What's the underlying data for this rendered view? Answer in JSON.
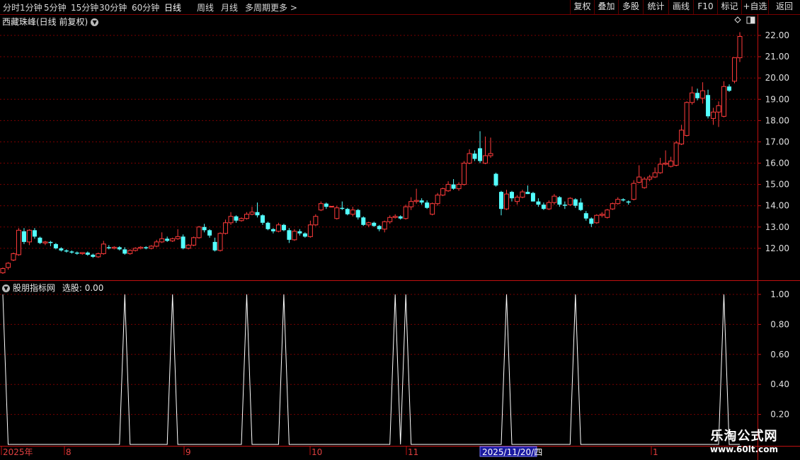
{
  "toolbar": {
    "periods": [
      "分时",
      "1分钟",
      "5分钟",
      "15分钟",
      "30分钟",
      "60分钟",
      "日线",
      "周线",
      "月线",
      "多周期",
      "更多 >"
    ],
    "active_period": "日线",
    "right_buttons": [
      "复权",
      "叠加",
      "多股",
      "统计",
      "画线",
      "F10",
      "标记",
      "+自选",
      "返回"
    ]
  },
  "main_chart": {
    "title": "西藏珠峰(日线 前复权)",
    "dropdown_icon": "chevron-down-icon",
    "price_labels": [
      "22.00",
      "21.00",
      "20.00",
      "19.00",
      "18.00",
      "17.00",
      "16.00",
      "15.00",
      "14.00",
      "13.00",
      "12.00"
    ],
    "up_color": "#ff3b3b",
    "down_color": "#54ffff"
  },
  "indicator": {
    "title": "股朋指标网",
    "select_label": "选股: 0.00",
    "axis_labels": [
      "1.00",
      "0.80",
      "0.60",
      "0.40",
      "0.20"
    ],
    "line_color": "#ffffff"
  },
  "time_axis": {
    "labels": [
      "2025年",
      "8",
      "9",
      "10",
      "11",
      "1"
    ],
    "cursor_date": "2025/11/20/四"
  },
  "chart_data": {
    "type": "candlestick",
    "candles": [
      [
        10.85,
        11.1,
        10.8,
        11.05
      ],
      [
        11.1,
        11.35,
        11.0,
        11.3
      ],
      [
        11.45,
        11.8,
        11.4,
        11.75
      ],
      [
        11.7,
        12.95,
        11.65,
        12.85
      ],
      [
        12.8,
        12.95,
        12.2,
        12.3
      ],
      [
        12.3,
        12.9,
        12.15,
        12.85
      ],
      [
        12.85,
        12.95,
        12.45,
        12.55
      ],
      [
        12.5,
        12.55,
        12.2,
        12.25
      ],
      [
        12.25,
        12.35,
        12.15,
        12.3
      ],
      [
        12.3,
        12.35,
        12.1,
        12.25
      ],
      [
        12.2,
        12.25,
        11.95,
        12.0
      ],
      [
        12.0,
        12.05,
        11.85,
        11.9
      ],
      [
        11.9,
        11.95,
        11.8,
        11.85
      ],
      [
        11.85,
        11.9,
        11.75,
        11.8
      ],
      [
        11.8,
        11.85,
        11.7,
        11.75
      ],
      [
        11.75,
        11.8,
        11.7,
        11.8
      ],
      [
        11.8,
        11.85,
        11.65,
        11.7
      ],
      [
        11.7,
        11.75,
        11.55,
        11.6
      ],
      [
        11.6,
        11.8,
        11.55,
        11.75
      ],
      [
        11.75,
        12.35,
        11.7,
        12.2
      ],
      [
        12.05,
        12.15,
        11.95,
        12.0
      ],
      [
        12.0,
        12.1,
        11.95,
        12.05
      ],
      [
        12.05,
        12.1,
        11.9,
        11.95
      ],
      [
        11.95,
        12.05,
        11.7,
        11.75
      ],
      [
        11.75,
        11.95,
        11.7,
        11.9
      ],
      [
        11.9,
        12.05,
        11.85,
        12.0
      ],
      [
        12.0,
        12.1,
        11.95,
        12.05
      ],
      [
        12.05,
        12.1,
        11.95,
        12.0
      ],
      [
        12.0,
        12.15,
        11.95,
        12.1
      ],
      [
        12.1,
        12.4,
        12.05,
        12.3
      ],
      [
        12.3,
        12.75,
        12.25,
        12.45
      ],
      [
        12.45,
        12.55,
        12.3,
        12.35
      ],
      [
        12.35,
        12.5,
        12.3,
        12.45
      ],
      [
        12.45,
        12.9,
        12.4,
        12.55
      ],
      [
        12.55,
        12.65,
        11.95,
        12.0
      ],
      [
        12.0,
        12.2,
        11.95,
        12.15
      ],
      [
        12.15,
        12.55,
        12.1,
        12.5
      ],
      [
        12.5,
        13.05,
        12.45,
        13.0
      ],
      [
        13.0,
        13.15,
        12.75,
        12.85
      ],
      [
        12.85,
        12.9,
        12.5,
        12.6
      ],
      [
        12.3,
        12.5,
        11.85,
        11.9
      ],
      [
        11.9,
        12.75,
        11.85,
        12.7
      ],
      [
        12.7,
        13.35,
        12.65,
        13.2
      ],
      [
        13.2,
        13.7,
        13.1,
        13.5
      ],
      [
        13.5,
        13.55,
        13.2,
        13.3
      ],
      [
        13.3,
        13.45,
        13.25,
        13.4
      ],
      [
        13.4,
        13.7,
        13.35,
        13.6
      ],
      [
        13.6,
        13.95,
        13.55,
        13.7
      ],
      [
        13.7,
        14.15,
        13.45,
        13.55
      ],
      [
        13.55,
        13.6,
        13.1,
        13.2
      ],
      [
        13.2,
        13.25,
        12.85,
        12.9
      ],
      [
        12.9,
        12.95,
        12.7,
        12.8
      ],
      [
        12.8,
        13.2,
        12.75,
        13.1
      ],
      [
        13.1,
        13.15,
        12.8,
        12.85
      ],
      [
        12.85,
        12.95,
        12.25,
        12.4
      ],
      [
        12.4,
        12.9,
        12.35,
        12.8
      ],
      [
        12.8,
        12.9,
        12.6,
        12.7
      ],
      [
        12.7,
        12.75,
        12.5,
        12.55
      ],
      [
        12.55,
        13.3,
        12.5,
        13.1
      ],
      [
        13.1,
        13.6,
        13.05,
        13.5
      ],
      [
        13.8,
        14.2,
        13.75,
        14.1
      ],
      [
        14.1,
        14.15,
        13.85,
        13.95
      ],
      [
        13.95,
        13.98,
        13.95,
        13.97
      ],
      [
        13.4,
        14.0,
        13.35,
        13.9
      ],
      [
        13.9,
        14.2,
        13.8,
        13.85
      ],
      [
        13.85,
        13.9,
        13.55,
        13.6
      ],
      [
        13.6,
        13.95,
        13.5,
        13.8
      ],
      [
        13.8,
        13.85,
        13.35,
        13.45
      ],
      [
        13.45,
        13.5,
        13.05,
        13.1
      ],
      [
        13.1,
        13.25,
        13.0,
        13.2
      ],
      [
        13.2,
        13.25,
        13.0,
        13.05
      ],
      [
        13.05,
        13.1,
        12.8,
        12.9
      ],
      [
        12.9,
        13.3,
        12.75,
        13.25
      ],
      [
        13.25,
        13.55,
        13.15,
        13.45
      ],
      [
        13.45,
        13.6,
        13.4,
        13.5
      ],
      [
        13.5,
        13.55,
        13.35,
        13.4
      ],
      [
        13.4,
        14.05,
        13.35,
        13.95
      ],
      [
        13.95,
        14.4,
        13.8,
        14.2
      ],
      [
        14.2,
        14.8,
        14.1,
        14.25
      ],
      [
        14.25,
        14.35,
        14.05,
        14.15
      ],
      [
        14.15,
        14.25,
        13.85,
        13.9
      ],
      [
        13.6,
        14.15,
        13.55,
        14.1
      ],
      [
        14.1,
        14.6,
        14.0,
        14.5
      ],
      [
        14.5,
        14.85,
        14.45,
        14.8
      ],
      [
        14.7,
        15.15,
        14.65,
        15.0
      ],
      [
        15.0,
        15.25,
        14.75,
        14.8
      ],
      [
        14.8,
        15.1,
        14.7,
        15.0
      ],
      [
        15.0,
        16.1,
        14.95,
        16.0
      ],
      [
        16.0,
        16.65,
        15.95,
        16.45
      ],
      [
        16.45,
        16.6,
        16.1,
        16.2
      ],
      [
        16.7,
        17.5,
        16.0,
        16.1
      ],
      [
        16.0,
        17.25,
        15.95,
        16.35
      ],
      [
        16.35,
        17.2,
        16.25,
        16.45
      ],
      [
        15.5,
        15.55,
        14.9,
        14.95
      ],
      [
        14.65,
        14.7,
        13.55,
        13.85
      ],
      [
        13.85,
        14.75,
        13.8,
        14.55
      ],
      [
        14.65,
        14.7,
        14.2,
        14.35
      ],
      [
        14.2,
        14.5,
        14.05,
        14.4
      ],
      [
        14.4,
        14.75,
        14.35,
        14.65
      ],
      [
        14.65,
        14.95,
        14.55,
        14.55
      ],
      [
        14.6,
        14.65,
        14.2,
        14.2
      ],
      [
        14.2,
        14.35,
        13.95,
        14.05
      ],
      [
        14.05,
        14.15,
        13.8,
        13.85
      ],
      [
        13.85,
        14.25,
        13.8,
        14.15
      ],
      [
        14.15,
        14.55,
        14.05,
        14.45
      ],
      [
        14.4,
        14.45,
        13.95,
        14.05
      ],
      [
        14.05,
        14.2,
        13.85,
        14.0
      ],
      [
        14.05,
        14.4,
        14.0,
        14.35
      ],
      [
        14.3,
        14.35,
        13.9,
        14.0
      ],
      [
        14.15,
        14.35,
        13.75,
        13.8
      ],
      [
        13.65,
        13.75,
        13.3,
        13.4
      ],
      [
        13.4,
        13.45,
        13.0,
        13.15
      ],
      [
        13.2,
        13.6,
        13.15,
        13.55
      ],
      [
        13.55,
        13.7,
        13.45,
        13.6
      ],
      [
        13.45,
        13.85,
        13.4,
        13.8
      ],
      [
        13.85,
        14.15,
        13.8,
        14.1
      ],
      [
        14.1,
        14.4,
        14.05,
        14.3
      ],
      [
        14.3,
        14.35,
        14.2,
        14.25
      ],
      [
        14.2,
        14.25,
        14.05,
        14.15
      ],
      [
        14.3,
        15.2,
        14.25,
        15.05
      ],
      [
        15.1,
        15.9,
        15.05,
        15.35
      ],
      [
        14.85,
        15.35,
        14.8,
        15.25
      ],
      [
        15.25,
        15.45,
        15.15,
        15.35
      ],
      [
        15.35,
        15.8,
        15.3,
        15.55
      ],
      [
        15.55,
        16.25,
        15.5,
        15.95
      ],
      [
        15.95,
        16.6,
        15.9,
        16.0
      ],
      [
        15.85,
        16.3,
        15.8,
        16.1
      ],
      [
        15.9,
        17.05,
        15.85,
        16.95
      ],
      [
        16.9,
        17.8,
        16.85,
        17.55
      ],
      [
        17.3,
        18.9,
        17.25,
        18.85
      ],
      [
        18.85,
        19.6,
        18.75,
        19.3
      ],
      [
        19.3,
        19.5,
        18.95,
        19.05
      ],
      [
        19.05,
        19.8,
        18.8,
        19.4
      ],
      [
        19.2,
        19.45,
        18.1,
        18.2
      ],
      [
        18.1,
        18.6,
        17.8,
        18.4
      ],
      [
        18.4,
        18.9,
        17.7,
        18.7
      ],
      [
        18.2,
        19.85,
        18.15,
        19.6
      ],
      [
        19.6,
        19.7,
        19.35,
        19.4
      ],
      [
        19.85,
        20.95,
        19.75,
        20.95
      ],
      [
        20.95,
        22.15,
        20.75,
        21.95
      ]
    ],
    "signal_positions": [
      0,
      23,
      32,
      46,
      53,
      74,
      76,
      95,
      108,
      136,
      143,
      155,
      187
    ],
    "signal_range": [
      0,
      1
    ],
    "price_range": [
      10.5,
      22.4
    ]
  }
}
